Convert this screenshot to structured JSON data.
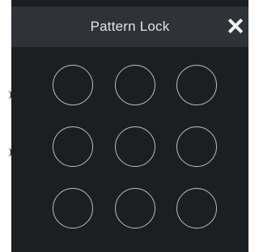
{
  "dialog": {
    "title": "Pattern Lock",
    "close_icon": "close-icon"
  },
  "pattern_grid": {
    "rows": 3,
    "columns": 3,
    "dots": [
      {
        "row": 1,
        "col": 1
      },
      {
        "row": 1,
        "col": 2
      },
      {
        "row": 1,
        "col": 3
      },
      {
        "row": 2,
        "col": 1
      },
      {
        "row": 2,
        "col": 2
      },
      {
        "row": 2,
        "col": 3
      },
      {
        "row": 3,
        "col": 1
      },
      {
        "row": 3,
        "col": 2
      },
      {
        "row": 3,
        "col": 3
      }
    ]
  },
  "colors": {
    "dialog_background": "#1b1f22",
    "titlebar_background": "#2f3337",
    "title_text": "#e1e4e7",
    "dot_outline": "#b9bec3"
  }
}
